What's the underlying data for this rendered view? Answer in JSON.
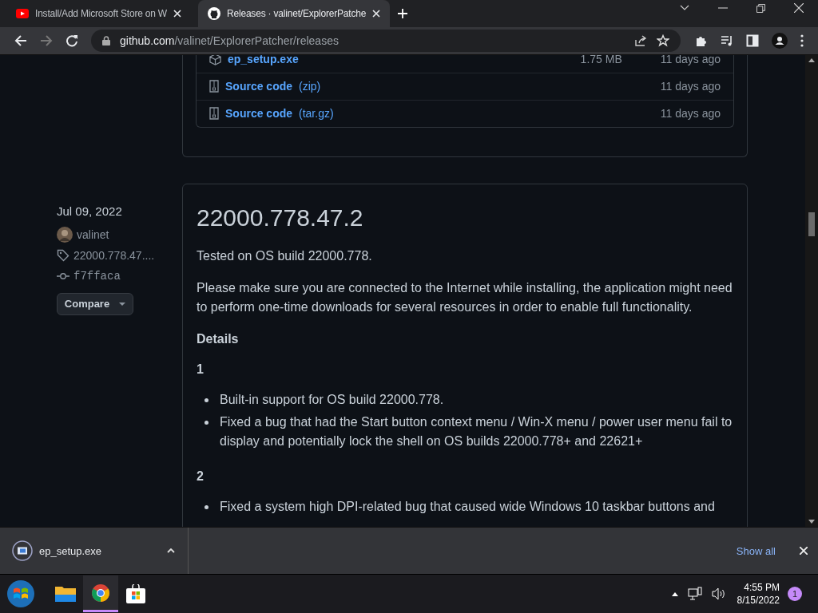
{
  "tabs": [
    {
      "title": "Install/Add Microsoft Store on W",
      "kind": "video",
      "selected": false
    },
    {
      "title": "Releases · valinet/ExplorerPatche",
      "kind": "github",
      "selected": true
    }
  ],
  "address": {
    "host": "github.com",
    "path": "/valinet/ExplorerPatcher/releases"
  },
  "assets": [
    {
      "name": "ep_setup.exe",
      "size": "1.75 MB",
      "age": "11 days ago",
      "kind": "package"
    },
    {
      "name": "Source code",
      "suffix": "(zip)",
      "age": "11 days ago",
      "kind": "archive"
    },
    {
      "name": "Source code",
      "suffix": "(tar.gz)",
      "age": "11 days ago",
      "kind": "archive"
    }
  ],
  "release": {
    "date": "Jul 09, 2022",
    "author": "valinet",
    "tag": "22000.778.47....",
    "commit": "f7ffaca",
    "compare": "Compare",
    "title": "22000.778.47.2",
    "body": [
      {
        "kind": "p",
        "text": "Tested on OS build 22000.778."
      },
      {
        "kind": "p",
        "text": "Please make sure you are connected to the Internet while installing, the application might need to perform one-time downloads for several resources in order to enable full functionality."
      },
      {
        "kind": "h",
        "text": "Details"
      },
      {
        "kind": "num",
        "text": "1"
      },
      {
        "kind": "ul",
        "items": [
          "Built-in support for OS build 22000.778.",
          "Fixed a bug that had the Start button context menu / Win-X menu / power user menu fail to display and potentially lock the shell on OS builds 22000.778+ and 22621+"
        ]
      },
      {
        "kind": "num",
        "text": "2"
      },
      {
        "kind": "ul",
        "items": [
          "Fixed a system high DPI-related bug that caused wide Windows 10 taskbar buttons and"
        ]
      }
    ]
  },
  "download": {
    "file": "ep_setup.exe",
    "show_all": "Show all"
  },
  "taskbar": {
    "time": "4:55 PM",
    "date": "8/15/2022",
    "notifications": "1"
  }
}
